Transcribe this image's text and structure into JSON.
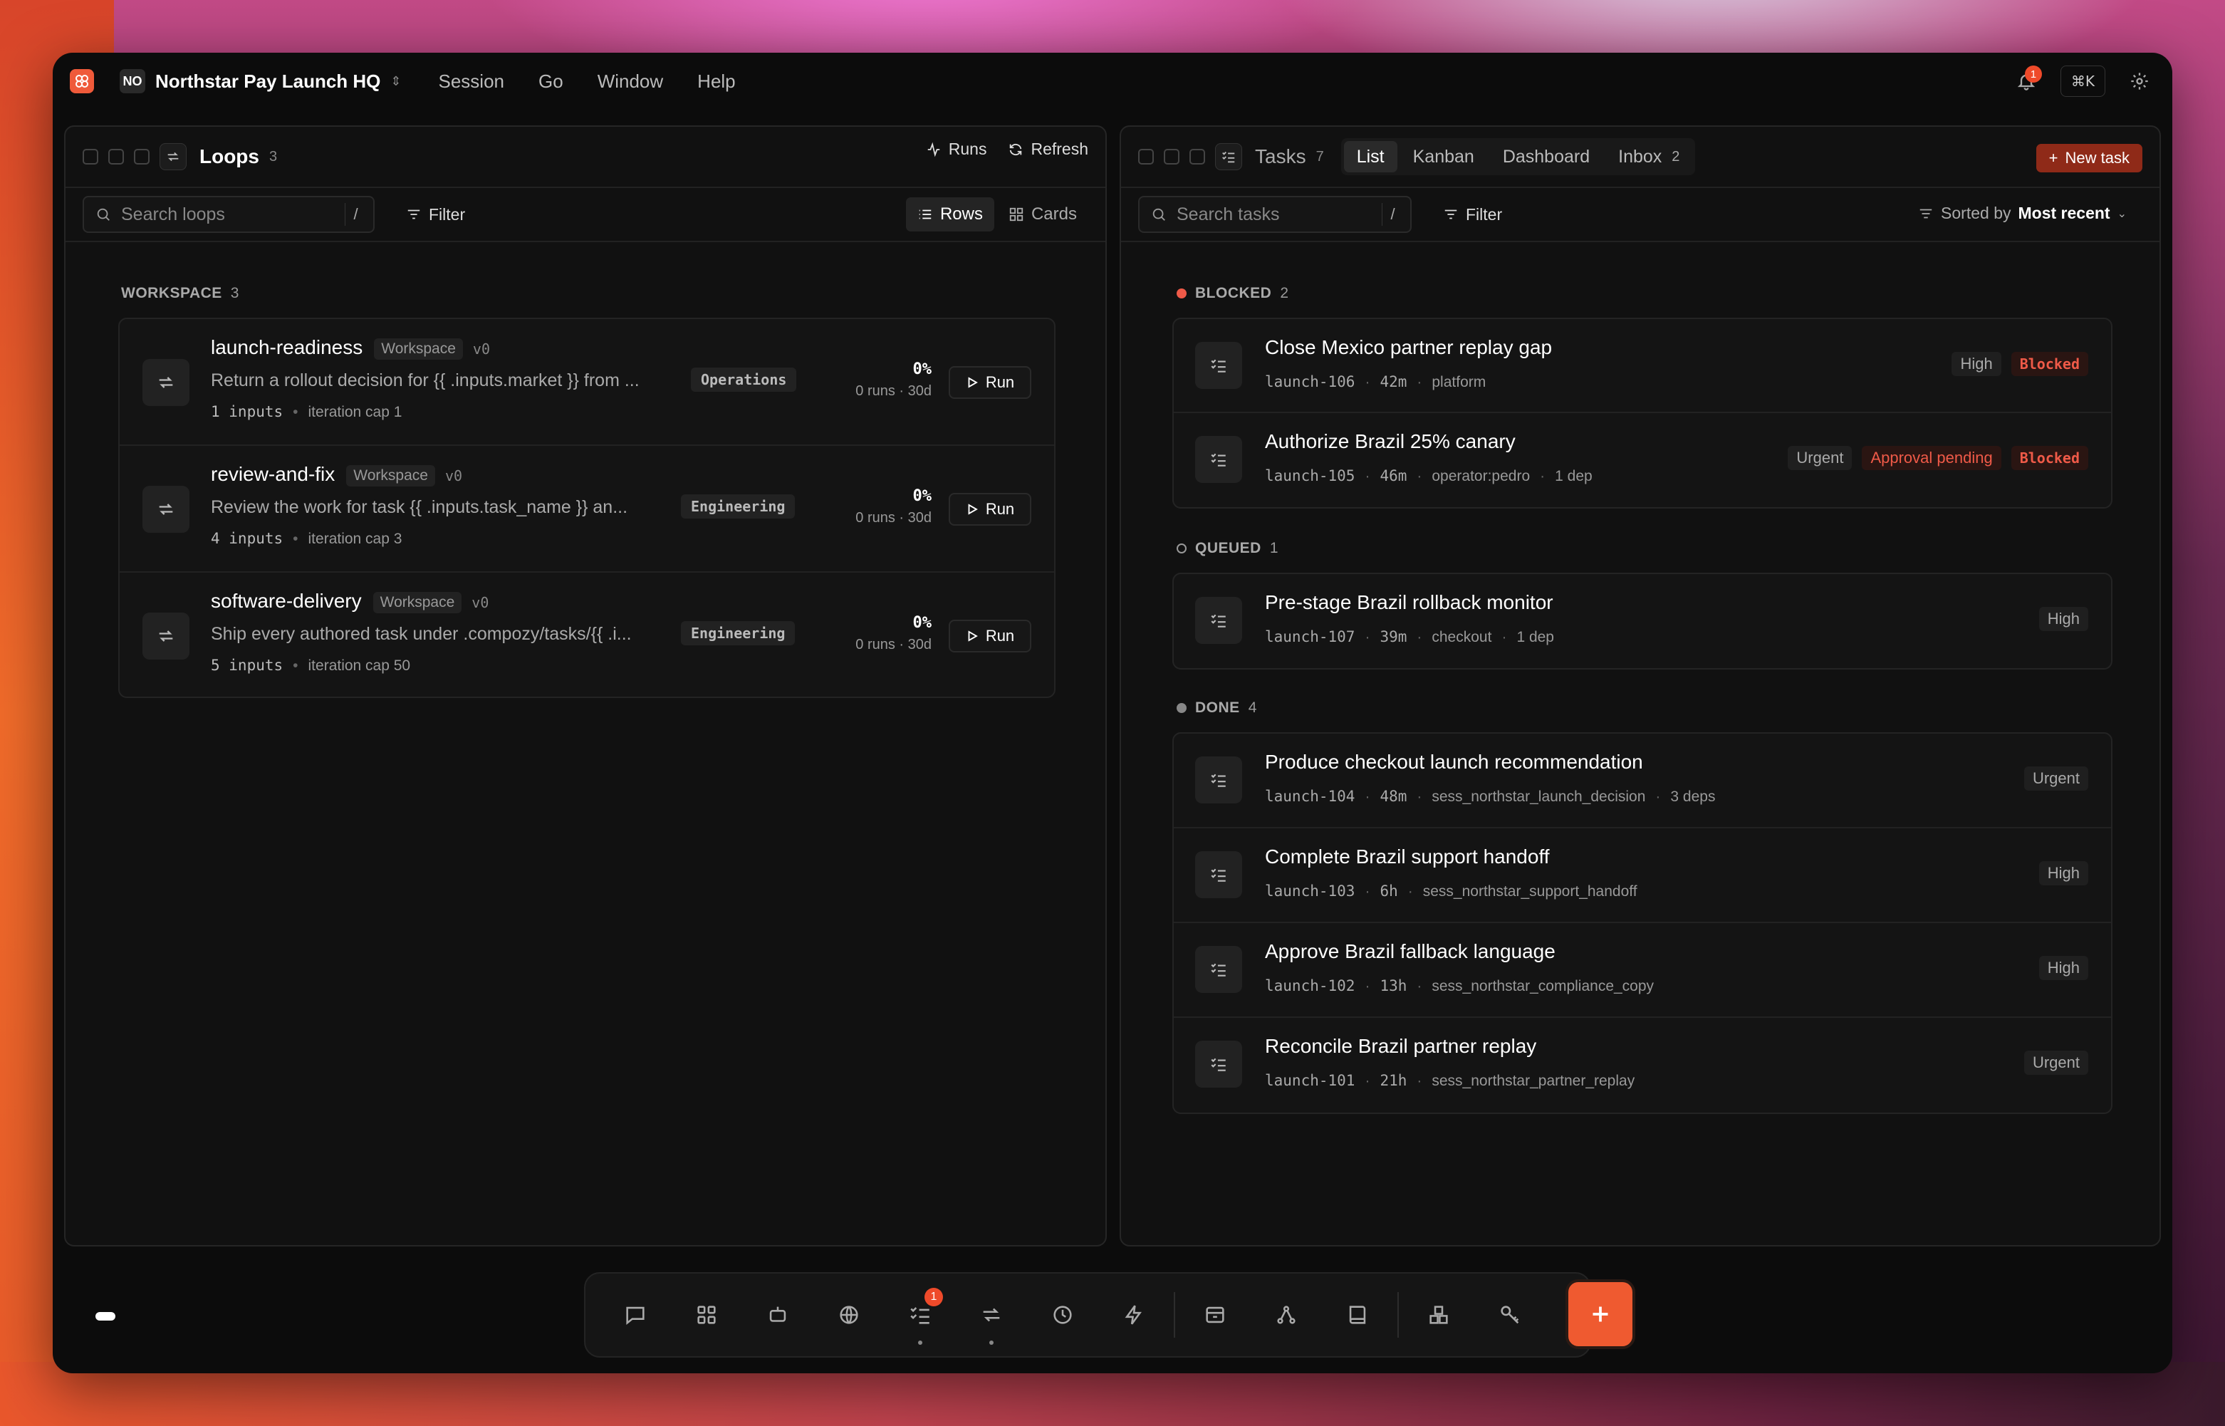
{
  "app": {
    "workspace_initials": "NO",
    "workspace_name": "Northstar Pay Launch HQ",
    "notifications": "1",
    "shortcut": "⌘K"
  },
  "menu": [
    "Session",
    "Go",
    "Window",
    "Help"
  ],
  "loops_panel": {
    "title": "Loops",
    "count": "3",
    "runs_label": "Runs",
    "refresh_label": "Refresh",
    "search_placeholder": "Search loops",
    "search_key": "/",
    "filter_label": "Filter",
    "view_rows": "Rows",
    "view_cards": "Cards",
    "section": {
      "label": "WORKSPACE",
      "count": "3"
    },
    "loops": [
      {
        "name": "launch-readiness",
        "scope": "Workspace",
        "version": "v0",
        "description": "Return a rollout decision for {{ .inputs.market }} from ...",
        "team": "Operations",
        "inputs": "1 inputs",
        "cap": "iteration cap 1",
        "pct": "0%",
        "runs": "0 runs · 30d",
        "run_label": "Run"
      },
      {
        "name": "review-and-fix",
        "scope": "Workspace",
        "version": "v0",
        "description": "Review the work for task {{ .inputs.task_name }} an...",
        "team": "Engineering",
        "inputs": "4 inputs",
        "cap": "iteration cap 3",
        "pct": "0%",
        "runs": "0 runs · 30d",
        "run_label": "Run"
      },
      {
        "name": "software-delivery",
        "scope": "Workspace",
        "version": "v0",
        "description": "Ship every authored task under .compozy/tasks/{{ .i...",
        "team": "Engineering",
        "inputs": "5 inputs",
        "cap": "iteration cap 50",
        "pct": "0%",
        "runs": "0 runs · 30d",
        "run_label": "Run"
      }
    ]
  },
  "tasks_panel": {
    "title": "Tasks",
    "count": "7",
    "tabs": [
      {
        "label": "List"
      },
      {
        "label": "Kanban"
      },
      {
        "label": "Dashboard"
      },
      {
        "label": "Inbox",
        "count": "2"
      }
    ],
    "new_task_label": "New task",
    "search_placeholder": "Search tasks",
    "search_key": "/",
    "filter_label": "Filter",
    "sort_prefix": "Sorted by",
    "sort_value": "Most recent",
    "groups": [
      {
        "label": "BLOCKED",
        "count": "2",
        "color": "#ef5a48",
        "tasks": [
          {
            "title": "Close Mexico partner replay gap",
            "id": "launch-106",
            "age": "42m",
            "owner": "platform",
            "deps": "",
            "badges": [
              {
                "text": "High",
                "style": "plain"
              },
              {
                "text": "Blocked",
                "style": "redm"
              }
            ]
          },
          {
            "title": "Authorize Brazil 25% canary",
            "id": "launch-105",
            "age": "46m",
            "owner": "operator:pedro",
            "deps": "1 dep",
            "badges": [
              {
                "text": "Urgent",
                "style": "plain"
              },
              {
                "text": "Approval pending",
                "style": "red"
              },
              {
                "text": "Blocked",
                "style": "redm"
              }
            ]
          }
        ]
      },
      {
        "label": "QUEUED",
        "count": "1",
        "color": "hollow",
        "tasks": [
          {
            "title": "Pre-stage Brazil rollback monitor",
            "id": "launch-107",
            "age": "39m",
            "owner": "checkout",
            "deps": "1 dep",
            "badges": [
              {
                "text": "High",
                "style": "plain"
              }
            ]
          }
        ]
      },
      {
        "label": "DONE",
        "count": "4",
        "color": "#888888",
        "tasks": [
          {
            "title": "Produce checkout launch recommendation",
            "id": "launch-104",
            "age": "48m",
            "owner": "sess_northstar_launch_decision",
            "deps": "3 deps",
            "badges": [
              {
                "text": "Urgent",
                "style": "plain"
              }
            ]
          },
          {
            "title": "Complete Brazil support handoff",
            "id": "launch-103",
            "age": "6h",
            "owner": "sess_northstar_support_handoff",
            "deps": "",
            "badges": [
              {
                "text": "High",
                "style": "plain"
              }
            ]
          },
          {
            "title": "Approve Brazil fallback language",
            "id": "launch-102",
            "age": "13h",
            "owner": "sess_northstar_compliance_copy",
            "deps": "",
            "badges": [
              {
                "text": "High",
                "style": "plain"
              }
            ]
          },
          {
            "title": "Reconcile Brazil partner replay",
            "id": "launch-101",
            "age": "21h",
            "owner": "sess_northstar_partner_replay",
            "deps": "",
            "badges": [
              {
                "text": "Urgent",
                "style": "plain"
              }
            ]
          }
        ]
      }
    ]
  },
  "dock": {
    "tasks_badge": "1",
    "items": [
      "chat-icon",
      "grid-icon",
      "bot-icon",
      "globe-icon",
      "tasks-icon",
      "loop-icon",
      "clock-icon",
      "bolt-icon",
      "archive-icon",
      "graph-icon",
      "book-icon",
      "blocks-icon",
      "key-icon"
    ]
  },
  "colors": {
    "accent": "#ef5a30",
    "danger": "#ef5a48",
    "background": "#0c0c0c",
    "panel": "#111111"
  }
}
